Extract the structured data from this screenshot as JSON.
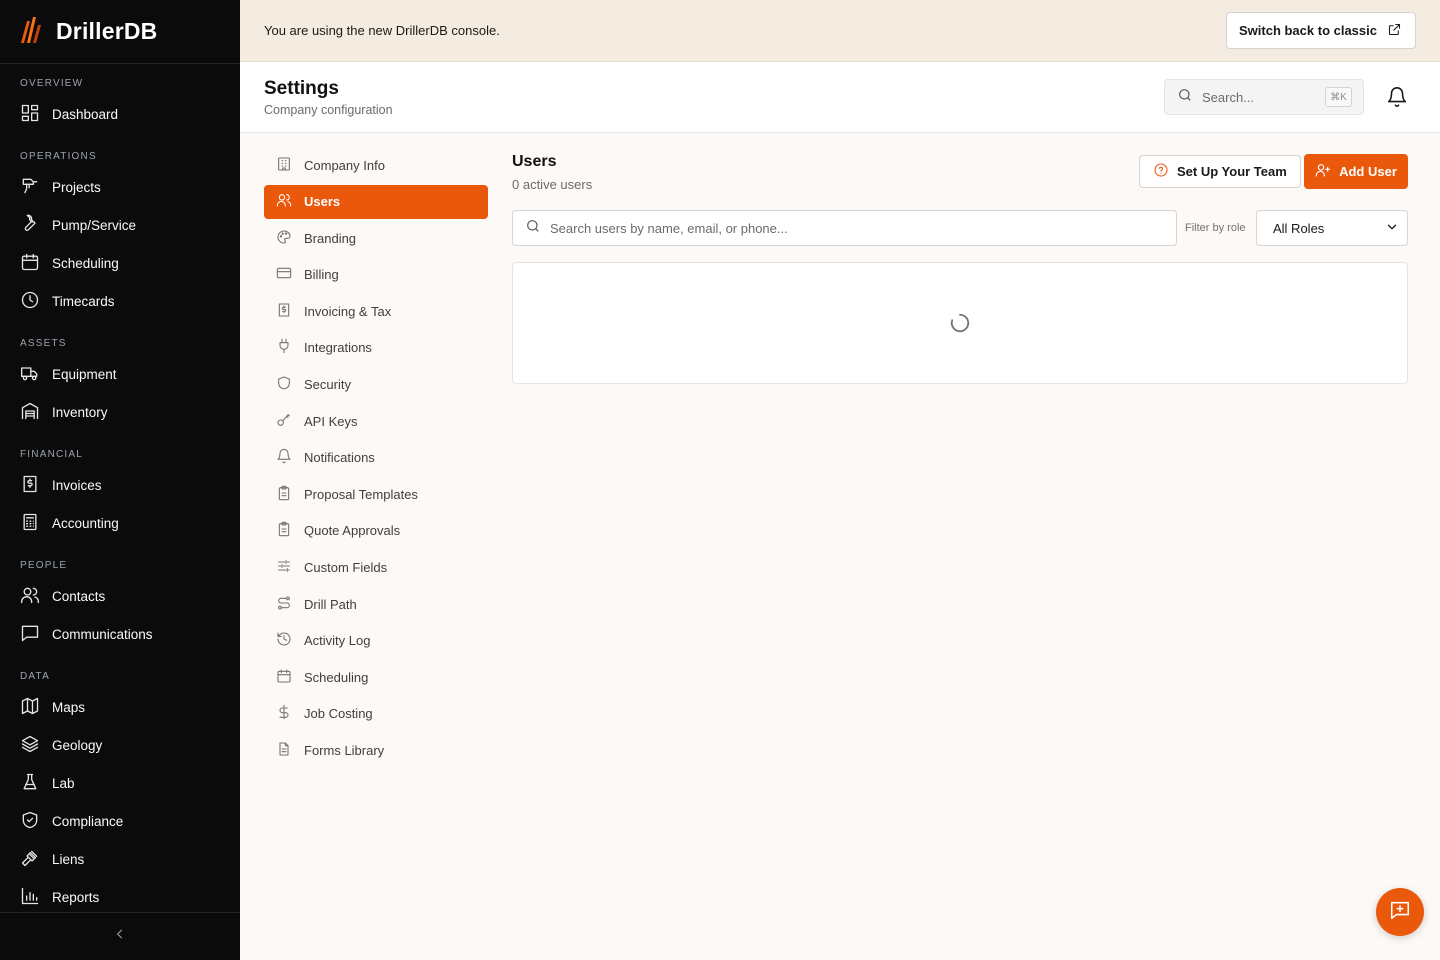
{
  "app": {
    "name": "DrillerDB"
  },
  "banner": {
    "text": "You are using the new DrillerDB console.",
    "button_label": "Switch back to classic"
  },
  "sidebar": {
    "sections": [
      {
        "label": "OVERVIEW",
        "items": [
          {
            "label": "Dashboard",
            "icon": "dashboard-icon"
          }
        ]
      },
      {
        "label": "OPERATIONS",
        "items": [
          {
            "label": "Projects",
            "icon": "drill-icon"
          },
          {
            "label": "Pump/Service",
            "icon": "wrench-icon"
          },
          {
            "label": "Scheduling",
            "icon": "calendar-icon"
          },
          {
            "label": "Timecards",
            "icon": "clock-icon"
          }
        ]
      },
      {
        "label": "ASSETS",
        "items": [
          {
            "label": "Equipment",
            "icon": "truck-icon"
          },
          {
            "label": "Inventory",
            "icon": "warehouse-icon"
          }
        ]
      },
      {
        "label": "FINANCIAL",
        "items": [
          {
            "label": "Invoices",
            "icon": "invoice-icon"
          },
          {
            "label": "Accounting",
            "icon": "calculator-icon"
          }
        ]
      },
      {
        "label": "PEOPLE",
        "items": [
          {
            "label": "Contacts",
            "icon": "users-icon"
          },
          {
            "label": "Communications",
            "icon": "message-icon"
          }
        ]
      },
      {
        "label": "DATA",
        "items": [
          {
            "label": "Maps",
            "icon": "map-icon"
          },
          {
            "label": "Geology",
            "icon": "layers-icon"
          },
          {
            "label": "Lab",
            "icon": "flask-icon"
          },
          {
            "label": "Compliance",
            "icon": "shield-check-icon"
          },
          {
            "label": "Liens",
            "icon": "gavel-icon"
          },
          {
            "label": "Reports",
            "icon": "bar-chart-icon"
          }
        ]
      }
    ]
  },
  "header": {
    "title": "Settings",
    "subtitle": "Company configuration",
    "search_placeholder": "Search...",
    "search_shortcut": "⌘K"
  },
  "settings_nav": {
    "items": [
      {
        "label": "Company Info",
        "icon": "building-icon",
        "active": false
      },
      {
        "label": "Users",
        "icon": "users-icon",
        "active": true
      },
      {
        "label": "Branding",
        "icon": "palette-icon",
        "active": false
      },
      {
        "label": "Billing",
        "icon": "credit-card-icon",
        "active": false
      },
      {
        "label": "Invoicing & Tax",
        "icon": "receipt-icon",
        "active": false
      },
      {
        "label": "Integrations",
        "icon": "plug-icon",
        "active": false
      },
      {
        "label": "Security",
        "icon": "shield-icon",
        "active": false
      },
      {
        "label": "API Keys",
        "icon": "key-icon",
        "active": false
      },
      {
        "label": "Notifications",
        "icon": "bell-icon",
        "active": false
      },
      {
        "label": "Proposal Templates",
        "icon": "clipboard-icon",
        "active": false
      },
      {
        "label": "Quote Approvals",
        "icon": "clipboard-check-icon",
        "active": false
      },
      {
        "label": "Custom Fields",
        "icon": "sliders-icon",
        "active": false
      },
      {
        "label": "Drill Path",
        "icon": "route-icon",
        "active": false
      },
      {
        "label": "Activity Log",
        "icon": "history-icon",
        "active": false
      },
      {
        "label": "Scheduling",
        "icon": "calendar-icon",
        "active": false
      },
      {
        "label": "Job Costing",
        "icon": "dollar-icon",
        "active": false
      },
      {
        "label": "Forms Library",
        "icon": "file-text-icon",
        "active": false
      }
    ]
  },
  "users": {
    "title": "Users",
    "count_text": "0 active users",
    "setup_button": "Set Up Your Team",
    "add_button": "Add User",
    "search_placeholder": "Search users by name, email, or phone...",
    "filter_label": "Filter by role",
    "role_selected": "All Roles"
  },
  "colors": {
    "accent": "#ea580c",
    "sidebar_bg": "#0b0b0b",
    "banner_bg": "#f5ece1",
    "page_bg": "#fcf9f6"
  }
}
